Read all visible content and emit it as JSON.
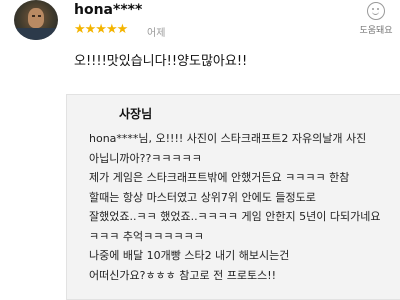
{
  "review": {
    "username": "hona****",
    "stars": "★★★★★",
    "date": "어제",
    "text": "오!!!!맛있습니다!!양도많아요!!",
    "helpful_label": "도움돼요",
    "helpful_icon": "smiley-icon",
    "rating": 5
  },
  "reply": {
    "owner_label": "사장님",
    "lines": [
      "hona****님, 오!!!! 사진이 스타크래프트2 자유의날개 사진",
      "아닙니까아??ㅋㅋㅋㅋㅋ",
      "제가 게임은 스타크래프트밖에 안했거든요 ㅋㅋㅋㅋ 한참",
      "할때는 항상 마스터였고 상위7위 안에도 들정도로",
      "잘했었죠..ㅋㅋ 했었죠..ㅋㅋㅋㅋ 게임 안한지 5년이 다되가네요",
      "ㅋㅋㅋ 추억ㅋㅋㅋㅋㅋㅋ",
      "나중에 배달 10개빵 스타2 내기 해보시는건",
      "어떠신가요?ㅎㅎㅎ 참고로 전 프로토스!!"
    ]
  },
  "colors": {
    "star": "#f4b400",
    "reply_bg": "#f3f3f3",
    "muted": "#9a9a9a"
  }
}
